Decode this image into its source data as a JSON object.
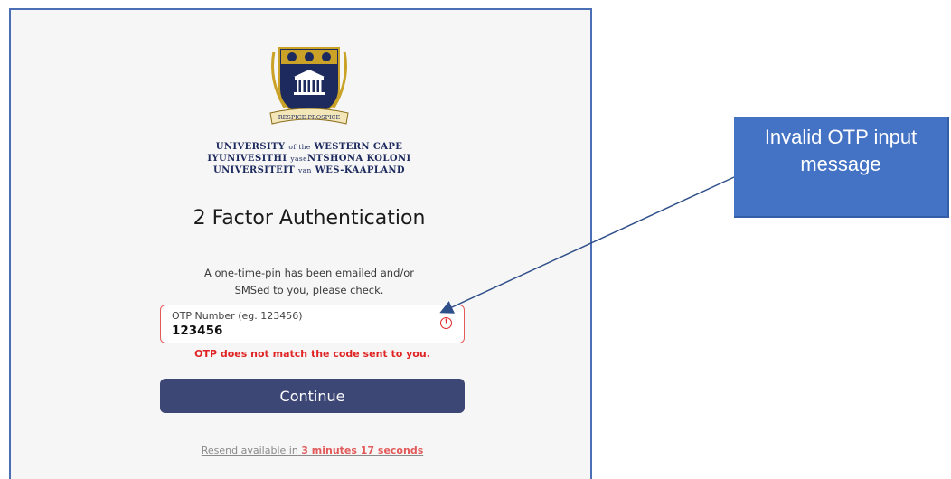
{
  "university": {
    "line1_main": "UNIVERSITY",
    "line1_small": "of the",
    "line1_end": "WESTERN CAPE",
    "line2_main": "IYUNIVESITHI",
    "line2_small": "yase",
    "line2_end": "NTSHONA KOLONI",
    "line3_main": "UNIVERSITEIT",
    "line3_small": "van",
    "line3_end": "WES-KAAPLAND",
    "motto": "RESPICE PROSPICE"
  },
  "page": {
    "title": "2 Factor Authentication",
    "subtitle_line1": "A one-time-pin has been emailed and/or",
    "subtitle_line2": "SMSed to you, please check."
  },
  "otp": {
    "label": "OTP Number (eg. 123456)",
    "value": "123456",
    "error_icon": "!",
    "error_message": "OTP does not match the code sent to you."
  },
  "actions": {
    "continue_label": "Continue",
    "resend_prefix": "Resend available in",
    "resend_time": "3 minutes 17 seconds"
  },
  "annotation": {
    "line1": "Invalid OTP input",
    "line2": "message"
  },
  "colors": {
    "error": "#e02424",
    "button": "#3c4775",
    "callout": "#4472c4",
    "crest_navy": "#1d2a5e",
    "crest_gold": "#c9a227"
  },
  "icons": [
    "university-crest-logo",
    "error-icon",
    "arrow-icon"
  ]
}
